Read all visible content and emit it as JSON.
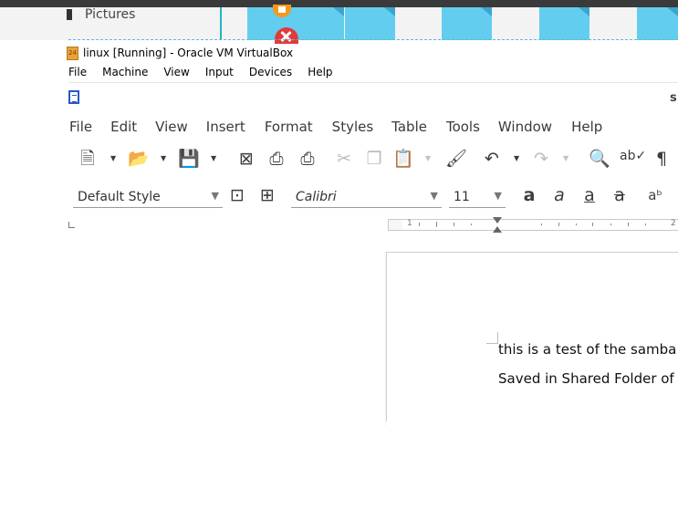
{
  "desktop": {
    "folder_label": "Pictures"
  },
  "vbox": {
    "title": "linux [Running] - Oracle VM VirtualBox",
    "logo_text": "24",
    "menu": [
      "File",
      "Machine",
      "View",
      "Input",
      "Devices",
      "Help"
    ]
  },
  "writer": {
    "title_fragment": "s",
    "menu": [
      "File",
      "Edit",
      "View",
      "Insert",
      "Format",
      "Styles",
      "Table",
      "Tools",
      "Window",
      "Help"
    ],
    "paragraph_style": "Default Style",
    "font_name": "Calibri",
    "font_size": "11",
    "ruler_numbers": [
      "1",
      "2"
    ],
    "document_lines": [
      "this is a test of the samba",
      "Saved in Shared Folder of"
    ]
  }
}
